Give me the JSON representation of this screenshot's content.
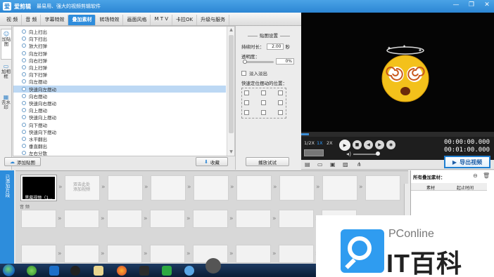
{
  "titlebar": {
    "logo": "爱",
    "app_name": "爱剪辑",
    "slogan": "最易用、强大的视频剪辑软件",
    "controls": [
      "—",
      "❐",
      "✕"
    ]
  },
  "tabs": [
    {
      "label": "视 频",
      "active": false
    },
    {
      "label": "音 频",
      "active": false
    },
    {
      "label": "字幕特效",
      "active": false
    },
    {
      "label": "叠加素材",
      "active": true
    },
    {
      "label": "转场特效",
      "active": false
    },
    {
      "label": "画面风格",
      "active": false
    },
    {
      "label": "M T V",
      "active": false
    },
    {
      "label": "卡拉OK",
      "active": false
    },
    {
      "label": "升级与服务",
      "active": false
    }
  ],
  "side_tabs": [
    {
      "label": "加贴图",
      "icon": "sticker-icon",
      "active": true
    },
    {
      "label": "加相框",
      "icon": "frame-icon",
      "active": false
    },
    {
      "label": "去水印",
      "icon": "watermark-icon",
      "active": false
    }
  ],
  "effects": [
    {
      "label": "向上扫出",
      "selected": false
    },
    {
      "label": "向下扫出",
      "selected": false
    },
    {
      "label": "放大扫弹",
      "selected": false
    },
    {
      "label": "向左扫弹",
      "selected": false
    },
    {
      "label": "向右扫弹",
      "selected": false
    },
    {
      "label": "向上扫弹",
      "selected": false
    },
    {
      "label": "向下扫弹",
      "selected": false
    },
    {
      "label": "向左摆动",
      "selected": false
    },
    {
      "label": "快速向左摆动",
      "selected": true
    },
    {
      "label": "向右摆动",
      "selected": false
    },
    {
      "label": "快速向右摆动",
      "selected": false
    },
    {
      "label": "向上摆动",
      "selected": false
    },
    {
      "label": "快速向上摆动",
      "selected": false
    },
    {
      "label": "向下摆动",
      "selected": false
    },
    {
      "label": "快速向下摆动",
      "selected": false
    },
    {
      "label": "水平翻出",
      "selected": false
    },
    {
      "label": "垂直翻出",
      "selected": false
    },
    {
      "label": "左右分散",
      "selected": false
    }
  ],
  "settings": {
    "title": "贴图设置",
    "duration_label": "持续时长：",
    "duration_value": "2.00",
    "duration_unit": "秒",
    "opacity_label": "透明度：",
    "opacity_value": "0%",
    "fade_label": "淡入淡出",
    "position_label": "快速定位摆动的位置："
  },
  "buttons": {
    "add_sticker": "添加贴图",
    "collect": "收藏",
    "preview_effect": "播放试试"
  },
  "player": {
    "speeds": [
      "1/2X",
      "1X",
      "2X"
    ],
    "active_speed": "1X",
    "time_current": "00:00:00.000",
    "time_total": "00:01:00.000",
    "export_label": "导出视频",
    "play_progress": 0.04
  },
  "timeline": {
    "side_label": "已添加片段",
    "first_clip_label": "黑幕视频（1...",
    "empty_hint": [
      "双击此处",
      "添加视频"
    ],
    "audio_label": "音 频"
  },
  "added_panel": {
    "title": "所有叠加素材：",
    "columns": [
      "素材",
      "起止时间"
    ]
  },
  "watermark": {
    "brand": "PConline",
    "text": "IT百科"
  },
  "colors": {
    "accent": "#2c86d4",
    "selected_row": "#bcd8f4",
    "timeline_tab": "#2d8ddc"
  }
}
